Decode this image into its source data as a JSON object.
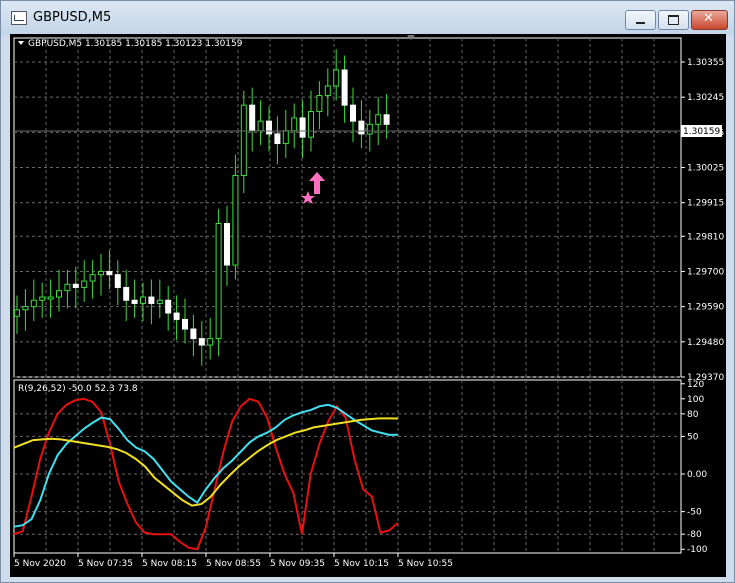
{
  "window": {
    "title": "GBPUSD,M5",
    "controls": [
      "minimize",
      "maximize",
      "close"
    ]
  },
  "main_chart": {
    "header": "GBPUSD,M5  1.30185 1.30185 1.30123 1.30159",
    "price_axis_labels": [
      "1.30355",
      "1.30245",
      "1.30135",
      "1.30025",
      "1.29915",
      "1.29810",
      "1.29700",
      "1.29590",
      "1.29480",
      "1.29370"
    ],
    "current_price": "1.30159",
    "signal_marker": "buy-arrow-icon"
  },
  "indicator": {
    "header": "R(9,26,52) -50.0 52.3 73.8",
    "axis_labels": [
      "120",
      "100",
      "80",
      "50",
      "0.00",
      "-50",
      "-80",
      "-100"
    ]
  },
  "time_axis": {
    "labels": [
      "5 Nov 2020",
      "5 Nov 07:35",
      "5 Nov 08:15",
      "5 Nov 08:55",
      "5 Nov 09:35",
      "5 Nov 10:15",
      "5 Nov 10:55"
    ]
  },
  "chart_data": {
    "type": "line",
    "title": "GBPUSD,M5",
    "ohlc": {
      "open": 1.30185,
      "high": 1.30185,
      "low": 1.30123,
      "close": 1.30159
    },
    "price_range": [
      1.2937,
      1.3043
    ],
    "price_close_series": [
      1.2958,
      1.2959,
      1.2961,
      1.2962,
      1.2962,
      1.2964,
      1.2966,
      1.2965,
      1.2967,
      1.2969,
      1.297,
      1.2969,
      1.2965,
      1.2961,
      1.296,
      1.2962,
      1.296,
      1.2961,
      1.2957,
      1.2955,
      1.2952,
      1.2949,
      1.2947,
      1.2949,
      1.2985,
      1.2972,
      1.3,
      1.3022,
      1.3014,
      1.3017,
      1.3013,
      1.301,
      1.3014,
      1.3018,
      1.3012,
      1.302,
      1.3025,
      1.3028,
      1.3033,
      1.3022,
      1.3017,
      1.3013,
      1.3016,
      1.3019,
      1.3016
    ],
    "series": [
      {
        "name": "R(9)",
        "color": "#e81010",
        "values": [
          -80,
          -76,
          -30,
          20,
          55,
          80,
          92,
          98,
          100,
          96,
          82,
          40,
          -10,
          -40,
          -65,
          -78,
          -80,
          -80,
          -80,
          -90,
          -98,
          -100,
          -70,
          -20,
          30,
          70,
          90,
          100,
          96,
          75,
          35,
          0,
          -25,
          -80,
          0,
          40,
          70,
          90,
          75,
          20,
          -20,
          -30,
          -78,
          -75,
          -65
        ]
      },
      {
        "name": "R(26)",
        "color": "#40e0f0",
        "values": [
          -70,
          -68,
          -60,
          -35,
          0,
          25,
          40,
          50,
          60,
          68,
          75,
          73,
          60,
          45,
          35,
          30,
          20,
          5,
          -10,
          -20,
          -30,
          -38,
          -20,
          -5,
          8,
          18,
          30,
          42,
          50,
          55,
          62,
          72,
          78,
          82,
          85,
          90,
          92,
          88,
          80,
          72,
          65,
          58,
          55,
          52,
          52.3
        ]
      },
      {
        "name": "R(52)",
        "color": "#f0e020",
        "values": [
          35,
          40,
          45,
          46,
          47,
          46,
          44,
          42,
          40,
          38,
          36,
          33,
          28,
          20,
          10,
          -5,
          -15,
          -25,
          -35,
          -42,
          -40,
          -30,
          -15,
          -2,
          10,
          20,
          30,
          38,
          45,
          50,
          55,
          58,
          62,
          64,
          66,
          68,
          70,
          72,
          73,
          74,
          74,
          73.8
        ]
      }
    ],
    "indicator_range": [
      -105,
      125
    ],
    "grid": true
  }
}
